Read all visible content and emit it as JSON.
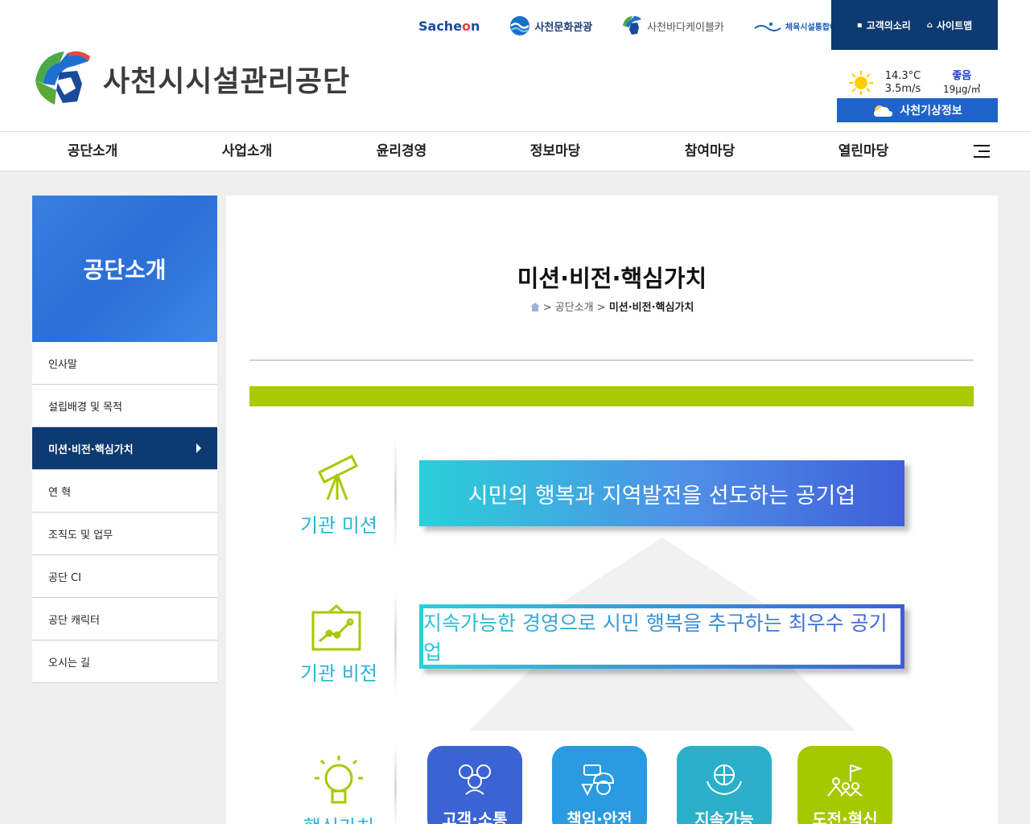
{
  "header": {
    "logo_text": "사천시시설관리공단",
    "partners": {
      "sacheon_prefix": "Sache",
      "sacheon_o": "o",
      "sacheon_suffix": "n",
      "culture": "사천문화관광",
      "cablecar": "사천바다케이블카",
      "sports": "체육시설통합예약"
    },
    "util": {
      "voice": "고객의소리",
      "sitemap": "사이트맵"
    },
    "weather": {
      "temp": "14.3°C",
      "wind": "3.5m/s",
      "air_status": "좋음",
      "air_value": "19μg/㎥",
      "button": "사천기상정보"
    }
  },
  "gnb": {
    "items": [
      "공단소개",
      "사업소개",
      "윤리경영",
      "정보마당",
      "참여마당",
      "열린마당"
    ]
  },
  "sidebar": {
    "title": "공단소개",
    "items": [
      "인사말",
      "설립배경 및 목적",
      "미션·비전·핵심가치",
      "연 혁",
      "조직도 및 업무",
      "공단 CI",
      "공단 캐릭터",
      "오시는 길"
    ],
    "active_index": 2
  },
  "content": {
    "title": "미션·비전·핵심가치",
    "breadcrumb": {
      "sep1": ">",
      "parent": "공단소개",
      "sep2": ">",
      "current": "미션·비전·핵심가치"
    },
    "mission": {
      "label": "기관 미션",
      "text": "시민의 행복과 지역발전을 선도하는 공기업"
    },
    "vision": {
      "label": "기관 비전",
      "text": "지속가능한 경영으로 시민 행복을 추구하는 최우수 공기업"
    },
    "values": {
      "label": "핵심가치",
      "items": [
        {
          "label": "고객·소통",
          "color": "#3a63d4",
          "icon": "people-chat-icon"
        },
        {
          "label": "책임·안전",
          "color": "#2a9be0",
          "icon": "helmet-worker-icon"
        },
        {
          "label": "지속가능",
          "color": "#2ab0c8",
          "icon": "globe-hands-icon"
        },
        {
          "label": "도전·혁신",
          "color": "#a6c800",
          "icon": "flag-climbers-icon"
        }
      ]
    }
  },
  "colors": {
    "navy": "#0d3a70",
    "blue": "#2a6fd6",
    "green_bar": "#a9cb00",
    "teal": "#2ab8c8"
  }
}
